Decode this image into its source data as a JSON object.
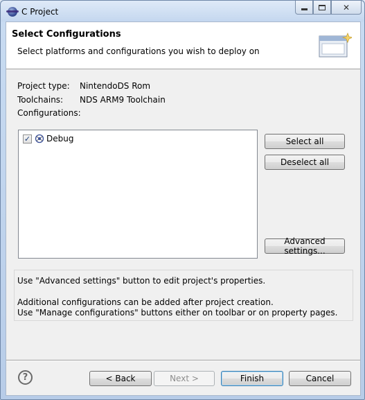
{
  "window": {
    "title": "C Project",
    "icon": "eclipse-app-icon"
  },
  "header": {
    "title": "Select Configurations",
    "description": "Select platforms and configurations you wish to deploy on",
    "icon": "wizard-banner-icon"
  },
  "project_info": {
    "project_type_label": "Project type:",
    "project_type_value": "NintendoDS Rom",
    "toolchains_label": "Toolchains:",
    "toolchains_value": "NDS ARM9 Toolchain",
    "configurations_label": "Configurations:"
  },
  "configurations": [
    {
      "label": "Debug",
      "checked": true,
      "icon": "debug-config-icon"
    }
  ],
  "side_buttons": {
    "select_all": "Select all",
    "deselect_all": "Deselect all",
    "advanced_settings": "Advanced settings..."
  },
  "message": {
    "line1": "Use \"Advanced settings\" button to edit project's properties.",
    "line2": "Additional configurations can be added after project creation.",
    "line3": "Use \"Manage configurations\" buttons either on toolbar or on property pages."
  },
  "footer": {
    "back": "< Back",
    "next": "Next >",
    "finish": "Finish",
    "cancel": "Cancel",
    "help_icon": "help-icon"
  },
  "colors": {
    "title_bar": "#c4d7ef",
    "dialog_background": "#f0f0f0",
    "default_button_border": "#3c7fb1"
  }
}
